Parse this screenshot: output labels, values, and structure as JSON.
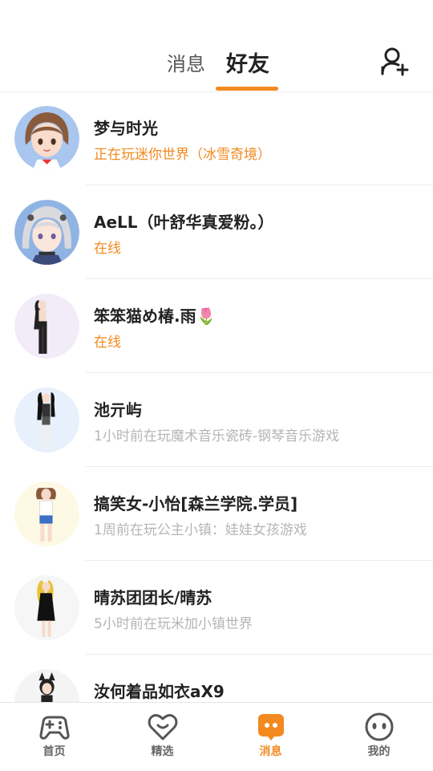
{
  "header": {
    "tabs": [
      {
        "label": "消息",
        "active": false
      },
      {
        "label": "好友",
        "active": true
      }
    ],
    "add_friend_icon": "add-user-icon"
  },
  "colors": {
    "accent": "#f28a20",
    "online": "#f28a20",
    "offline": "#b5b5b5",
    "name": "#222222"
  },
  "friends": [
    {
      "name": "梦与时光",
      "status": "正在玩迷你世界（冰雪奇境）",
      "state": "playing"
    },
    {
      "name": "AeLL（叶舒华真爱粉。）",
      "status": "在线",
      "state": "online"
    },
    {
      "name": "笨笨猫め椿.雨🌷",
      "status": "在线",
      "state": "online"
    },
    {
      "name": "池亓屿",
      "status": "1小时前在玩魔术音乐瓷砖-钢琴音乐游戏",
      "state": "offline"
    },
    {
      "name": "搞笑女-小怡[森兰学院.学员]",
      "status": "1周前在玩公主小镇：娃娃女孩游戏",
      "state": "offline"
    },
    {
      "name": "晴苏团团长/晴苏",
      "status": "5小时前在玩米加小镇世界",
      "state": "offline"
    },
    {
      "name": "汝何着品如衣aX9",
      "status": "",
      "state": "offline"
    }
  ],
  "nav": [
    {
      "label": "首页",
      "icon": "gamepad-icon",
      "active": false
    },
    {
      "label": "精选",
      "icon": "heart-icon",
      "active": false
    },
    {
      "label": "消息",
      "icon": "message-icon",
      "active": true
    },
    {
      "label": "我的",
      "icon": "face-icon",
      "active": false
    }
  ]
}
